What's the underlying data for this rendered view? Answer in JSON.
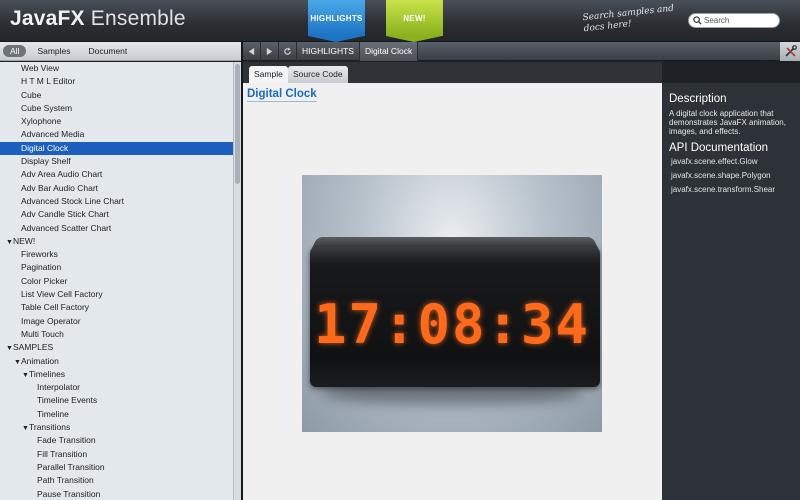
{
  "header": {
    "logo_bold": "JavaFX",
    "logo_light": " Ensemble",
    "ribbon_highlights": "HIGHLIGHTS",
    "ribbon_new": "NEW!",
    "search_hint": "Search samples and docs here!",
    "search_placeholder": "Search"
  },
  "filters": [
    "All",
    "Samples",
    "Document"
  ],
  "tree": [
    {
      "label": "Web View",
      "indent": 0
    },
    {
      "label": "H T M L Editor",
      "indent": 0
    },
    {
      "label": "Cube",
      "indent": 0
    },
    {
      "label": "Cube System",
      "indent": 0
    },
    {
      "label": "Xylophone",
      "indent": 0
    },
    {
      "label": "Advanced Media",
      "indent": 0
    },
    {
      "label": "Digital Clock",
      "indent": 0,
      "selected": true
    },
    {
      "label": "Display Shelf",
      "indent": 0
    },
    {
      "label": "Adv Area Audio Chart",
      "indent": 0
    },
    {
      "label": "Adv Bar Audio Chart",
      "indent": 0
    },
    {
      "label": "Advanced Stock Line Chart",
      "indent": 0
    },
    {
      "label": "Adv Candle Stick Chart",
      "indent": 0
    },
    {
      "label": "Advanced Scatter Chart",
      "indent": 0
    },
    {
      "label": "NEW!",
      "indent": -1,
      "expanded": true
    },
    {
      "label": "Fireworks",
      "indent": 0
    },
    {
      "label": "Pagination",
      "indent": 0
    },
    {
      "label": "Color Picker",
      "indent": 0
    },
    {
      "label": "List View Cell Factory",
      "indent": 0
    },
    {
      "label": "Table Cell Factory",
      "indent": 0
    },
    {
      "label": "Image Operator",
      "indent": 0
    },
    {
      "label": "Multi Touch",
      "indent": 0
    },
    {
      "label": "SAMPLES",
      "indent": -1,
      "expanded": true
    },
    {
      "label": "Animation",
      "indent": 0,
      "expanded": true
    },
    {
      "label": "Timelines",
      "indent": 1,
      "expanded": true
    },
    {
      "label": "Interpolator",
      "indent": 2
    },
    {
      "label": "Timeline Events",
      "indent": 2
    },
    {
      "label": "Timeline",
      "indent": 2
    },
    {
      "label": "Transitions",
      "indent": 1,
      "expanded": true
    },
    {
      "label": "Fade Transition",
      "indent": 2
    },
    {
      "label": "Fill Transition",
      "indent": 2
    },
    {
      "label": "Parallel Transition",
      "indent": 2
    },
    {
      "label": "Path Transition",
      "indent": 2
    },
    {
      "label": "Pause Transition",
      "indent": 2
    }
  ],
  "breadcrumbs": [
    "HIGHLIGHTS",
    "Digital Clock"
  ],
  "content_tabs": [
    "Sample",
    "Source Code"
  ],
  "sample": {
    "title": "Digital Clock",
    "clock_time": "17:08:34"
  },
  "side": {
    "description_heading": "Description",
    "description": "A digital clock application that demonstrates JavaFX animation, images, and effects.",
    "api_heading": "API Documentation",
    "api_links": [
      "javafx.scene.effect.Glow",
      "javafx.scene.shape.Polygon",
      "javafx.scene.transform.Shear"
    ]
  },
  "colors": {
    "accent": "#1d5fbd",
    "clock_digits": "#ff6a1a",
    "ribbon_highlights": "#1d73c4",
    "ribbon_new": "#8ab11d"
  }
}
